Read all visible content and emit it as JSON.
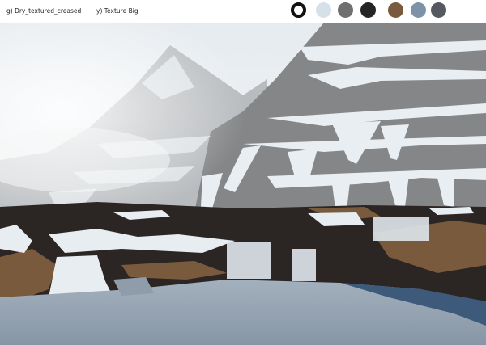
{
  "header": {
    "brush_label_left": "g) Dry_textured_creased",
    "brush_label_right": "y) Texture Big"
  },
  "palette": {
    "selected_index": 0,
    "swatches": [
      {
        "name": "selected-ring",
        "color": "#ffffff",
        "ring": "#111111"
      },
      {
        "name": "pale-ice",
        "color": "#d6e0e8"
      },
      {
        "name": "rock-grey",
        "color": "#6f6f70"
      },
      {
        "name": "charcoal",
        "color": "#262424"
      },
      {
        "name": "earth-brown",
        "color": "#7a5a3c"
      },
      {
        "name": "slate-blue",
        "color": "#7f93a8"
      },
      {
        "name": "storm-grey",
        "color": "#545a60"
      }
    ]
  },
  "artwork": {
    "sky_color": "#e8edf1",
    "mountain_color": "#8c8c8d",
    "snow_color": "#e9eef2",
    "ground_color": "#2b2523",
    "earth_color": "#7a5a3c",
    "water_color": "#9aa8b6",
    "deep_water_color": "#3d5a7a",
    "mist_color": "#f2f4f6"
  }
}
